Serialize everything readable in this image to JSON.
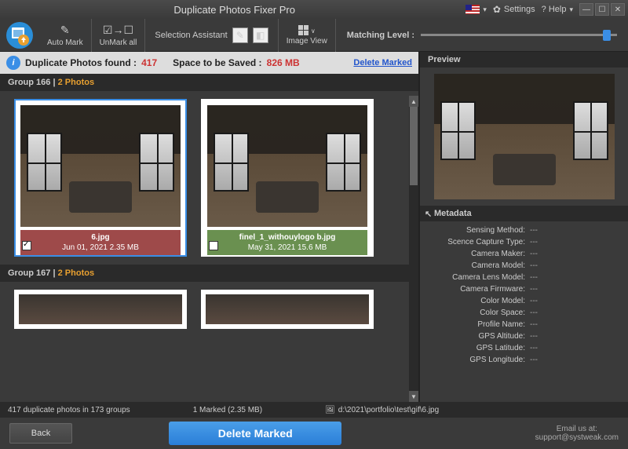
{
  "title": "Duplicate Photos Fixer Pro",
  "titlebar": {
    "settings": "Settings",
    "help": "? Help"
  },
  "toolbar": {
    "automark": "Auto Mark",
    "unmarkall": "UnMark all",
    "selassist": "Selection Assistant",
    "imgview": "Image View",
    "matchlevel": "Matching Level :"
  },
  "stats": {
    "found_label": "Duplicate Photos found :",
    "found": "417",
    "save_label": "Space to be Saved :",
    "save": "826 MB",
    "deletemarked": "Delete Marked"
  },
  "groups": {
    "g1": {
      "hdr": "Group 166",
      "photos_lbl": "Photos",
      "count": "2"
    },
    "g2": {
      "hdr": "Group 167",
      "photos_lbl": "Photos",
      "count": "2"
    }
  },
  "cards": {
    "c1": {
      "name": "6.jpg",
      "meta": "Jun 01, 2021    2.35 MB"
    },
    "c2": {
      "name": "finel_1_withouylogo b.jpg",
      "meta": "May 31, 2021    15.6 MB"
    }
  },
  "right": {
    "preview": "Preview",
    "metadata": "Metadata"
  },
  "metadata_rows": [
    {
      "k": "Sensing Method:",
      "v": "---"
    },
    {
      "k": "Scence Capture Type:",
      "v": "---"
    },
    {
      "k": "Camera Maker:",
      "v": "---"
    },
    {
      "k": "Camera Model:",
      "v": "---"
    },
    {
      "k": "Camera Lens Model:",
      "v": "---"
    },
    {
      "k": "Camera Firmware:",
      "v": "---"
    },
    {
      "k": "Color Model:",
      "v": "---"
    },
    {
      "k": "Color Space:",
      "v": "---"
    },
    {
      "k": "Profile Name:",
      "v": "---"
    },
    {
      "k": "GPS Altitude:",
      "v": "---"
    },
    {
      "k": "GPS Latitude:",
      "v": "---"
    },
    {
      "k": "GPS Longitude:",
      "v": "---"
    }
  ],
  "status": {
    "summary": "417 duplicate photos in 173 groups",
    "marked": "1 Marked (2.35 MB)",
    "path": "d:\\2021\\portfolio\\test\\gif\\6.jpg"
  },
  "bottom": {
    "back": "Back",
    "delete": "Delete Marked",
    "email_lbl": "Email us at:",
    "email": "support@systweak.com"
  }
}
